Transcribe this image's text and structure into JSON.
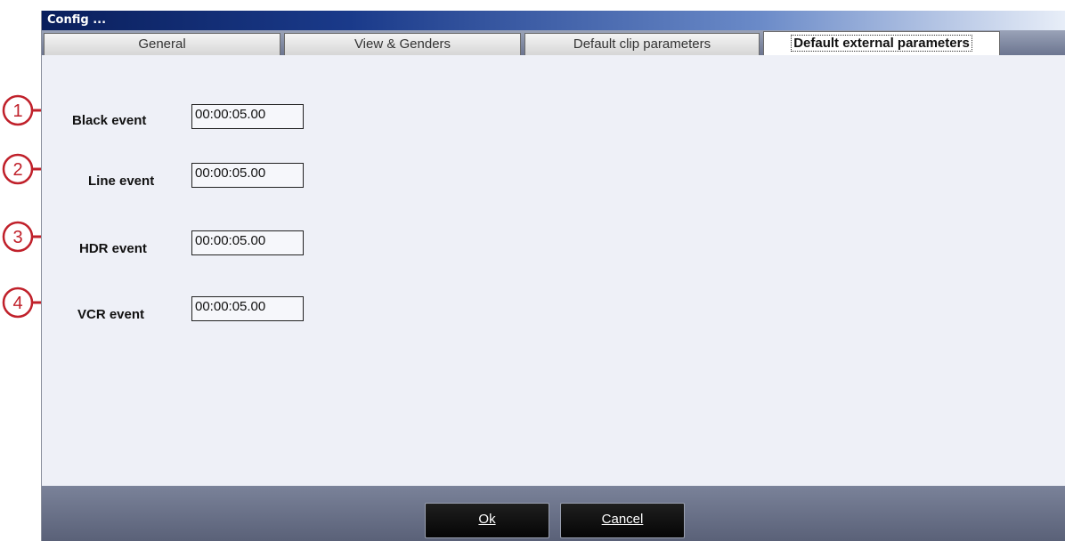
{
  "window": {
    "title": "Config ..."
  },
  "tabs": [
    {
      "label": "General",
      "active": false
    },
    {
      "label": "View & Genders",
      "active": false
    },
    {
      "label": "Default clip parameters",
      "active": false
    },
    {
      "label": "Default external parameters",
      "active": true
    }
  ],
  "events": [
    {
      "label": "Black event",
      "value": "00:00:05.00",
      "marker": "1"
    },
    {
      "label": "Line event",
      "value": "00:00:05.00",
      "marker": "2"
    },
    {
      "label": "HDR event",
      "value": "00:00:05.00",
      "marker": "3"
    },
    {
      "label": "VCR event",
      "value": "00:00:05.00",
      "marker": "4"
    }
  ],
  "buttons": {
    "ok_label": "Ok",
    "cancel_label": "Cancel"
  },
  "colors": {
    "callout": "#c0202a",
    "titlebar": "#0a1f5c"
  }
}
